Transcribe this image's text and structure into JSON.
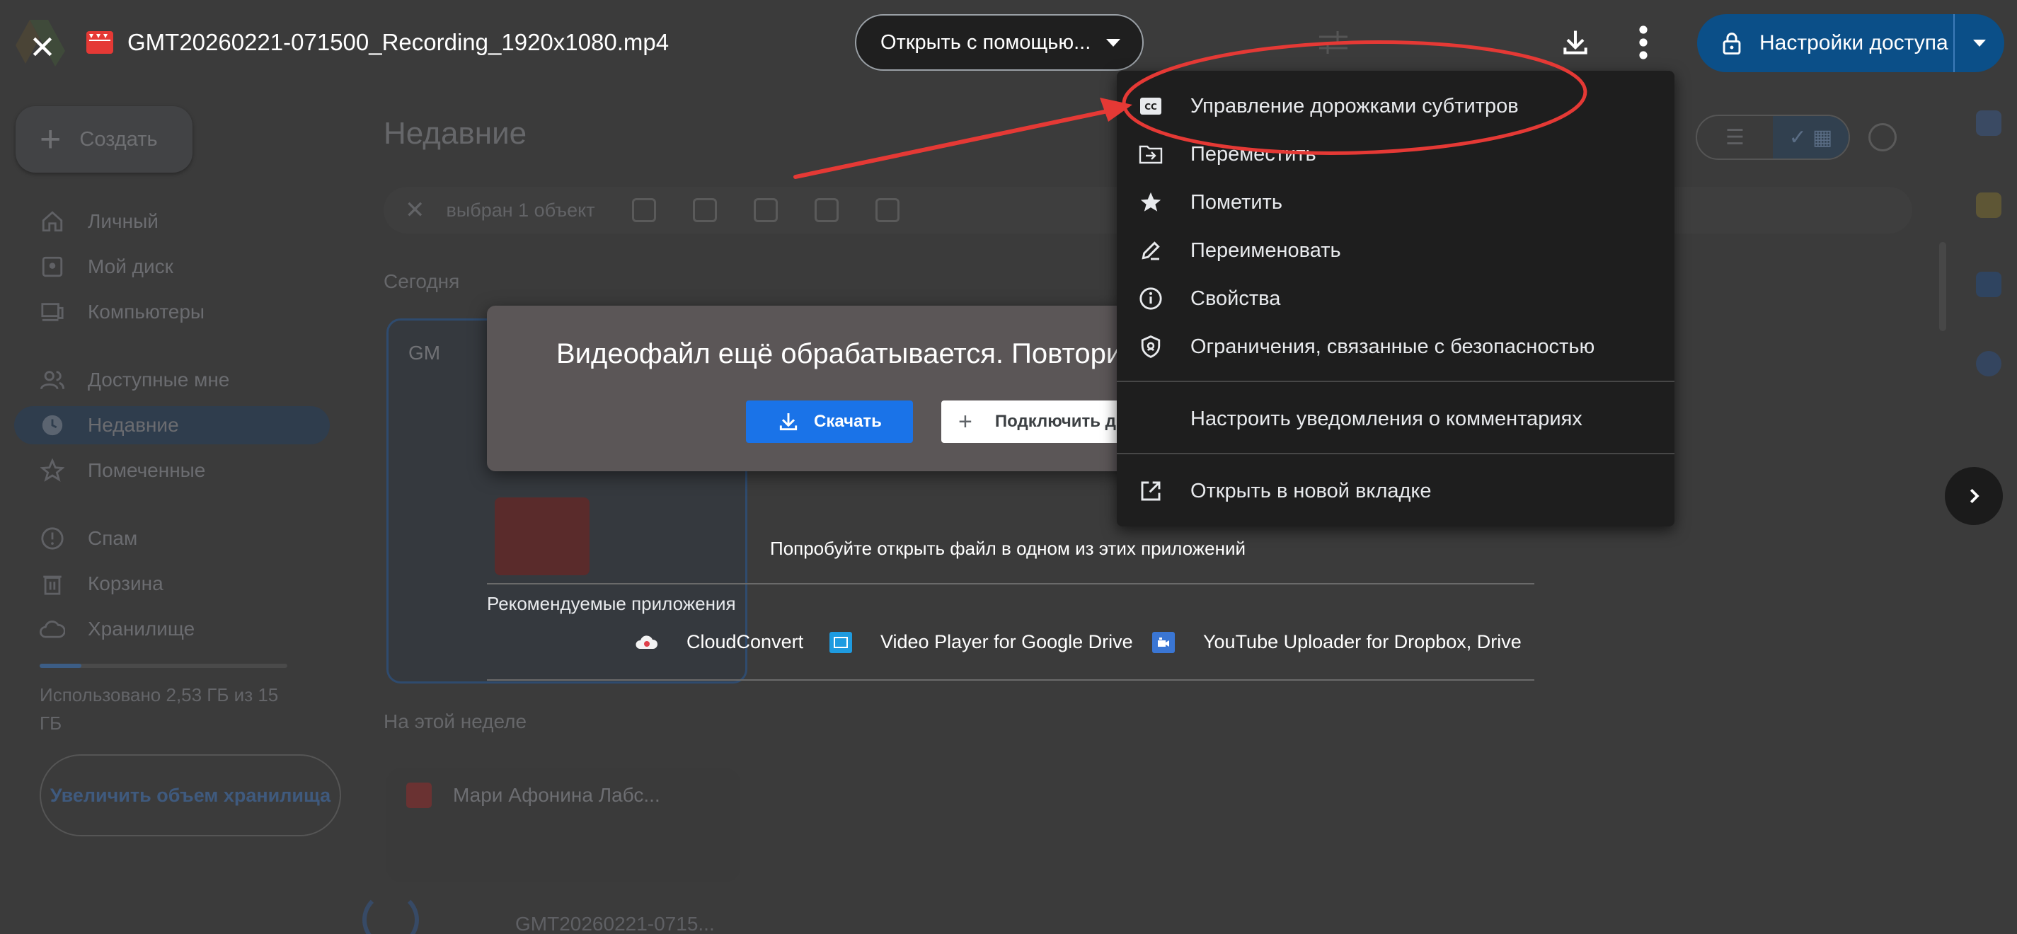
{
  "topbar": {
    "file_name": "GMT20260221-071500_Recording_1920x1080.mp4",
    "open_with_label": "Открыть с помощью...",
    "share_label": "Настройки доступа"
  },
  "background": {
    "create_label": "Создать",
    "nav": [
      {
        "label": "Личный",
        "icon": "home-icon"
      },
      {
        "label": "Мой диск",
        "icon": "drive-icon"
      },
      {
        "label": "Компьютеры",
        "icon": "computer-icon"
      },
      {
        "label": "Доступные мне",
        "icon": "people-icon"
      },
      {
        "label": "Недавние",
        "icon": "clock-icon"
      },
      {
        "label": "Помеченные",
        "icon": "star-icon"
      },
      {
        "label": "Спам",
        "icon": "spam-icon"
      },
      {
        "label": "Корзина",
        "icon": "trash-icon"
      },
      {
        "label": "Хранилище",
        "icon": "cloud-icon"
      }
    ],
    "storage_text": "Использовано 2,53 ГБ из 15 ГБ",
    "storage_fraction": 0.169,
    "upgrade_label": "Увеличить объем хранилища",
    "page_title": "Недавние",
    "selection_text": "выбран 1 объект",
    "section_today": "Сегодня",
    "today_file": "GM",
    "section_week": "На этой неделе",
    "week_file": "Мари Афонина Лабс...",
    "list_file": "GMT20260221-0715..."
  },
  "dialog": {
    "message": "Видеофайл ещё обрабатывается. Повторите",
    "download_label": "Скачать",
    "connect_label": "Подключить др"
  },
  "apps": {
    "try_text": "Попробуйте открыть файл в одном из этих приложений",
    "recommended_label": "Рекомендуемые приложения",
    "items": [
      {
        "label": "CloudConvert",
        "icon": "cloudconvert-icon"
      },
      {
        "label": "Video Player for Google Drive",
        "icon": "video-player-icon"
      },
      {
        "label": "YouTube Uploader for Dropbox, Drive",
        "icon": "youtube-uploader-icon"
      }
    ]
  },
  "menu": {
    "items": [
      {
        "label": "Управление дорожками субтитров",
        "icon": "captions-icon"
      },
      {
        "label": "Переместить",
        "icon": "move-icon"
      },
      {
        "label": "Пометить",
        "icon": "star-icon"
      },
      {
        "label": "Переименовать",
        "icon": "rename-icon"
      },
      {
        "label": "Свойства",
        "icon": "info-icon"
      },
      {
        "label": "Ограничения, связанные с безопасностью",
        "icon": "security-icon"
      },
      {
        "label": "Настроить уведомления о комментариях",
        "icon": ""
      },
      {
        "label": "Открыть в новой вкладке",
        "icon": "open-new-tab-icon"
      }
    ]
  },
  "colors": {
    "share_button": "#0b4f88",
    "download_button": "#1a73e8",
    "annotation": "#e53935"
  }
}
